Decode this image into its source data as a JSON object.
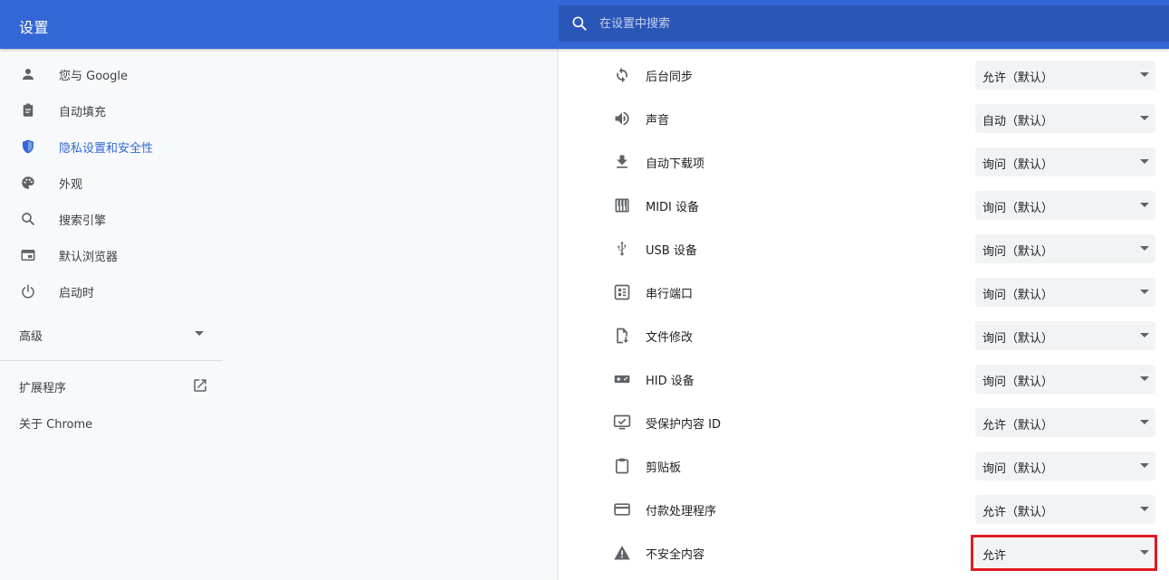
{
  "header": {
    "title": "设置",
    "search_placeholder": "在设置中搜索",
    "colors": {
      "bar": "#3367d6",
      "search_bg": "#2a56b8"
    }
  },
  "sidebar": {
    "items": [
      {
        "label": "您与 Google",
        "icon": "person-icon"
      },
      {
        "label": "自动填充",
        "icon": "clipboard-icon"
      },
      {
        "label": "隐私设置和安全性",
        "icon": "shield-icon",
        "active": true
      },
      {
        "label": "外观",
        "icon": "palette-icon"
      },
      {
        "label": "搜索引擎",
        "icon": "search-icon"
      },
      {
        "label": "默认浏览器",
        "icon": "browser-icon"
      },
      {
        "label": "启动时",
        "icon": "power-icon"
      }
    ],
    "advanced_label": "高级",
    "extensions_label": "扩展程序",
    "about_label": "关于 Chrome",
    "active_color": "#3367d6"
  },
  "permissions": [
    {
      "label": "后台同步",
      "value": "允许（默认）",
      "icon": "sync-icon"
    },
    {
      "label": "声音",
      "value": "自动（默认）",
      "icon": "speaker-icon"
    },
    {
      "label": "自动下载项",
      "value": "询问（默认）",
      "icon": "download-icon"
    },
    {
      "label": "MIDI 设备",
      "value": "询问（默认）",
      "icon": "piano-icon"
    },
    {
      "label": "USB 设备",
      "value": "询问（默认）",
      "icon": "usb-icon"
    },
    {
      "label": "串行端口",
      "value": "询问（默认）",
      "icon": "serial-port-icon"
    },
    {
      "label": "文件修改",
      "value": "询问（默认）",
      "icon": "file-edit-icon"
    },
    {
      "label": "HID 设备",
      "value": "询问（默认）",
      "icon": "gamepad-icon"
    },
    {
      "label": "受保护内容 ID",
      "value": "允许（默认）",
      "icon": "protected-content-icon"
    },
    {
      "label": "剪贴板",
      "value": "询问（默认）",
      "icon": "clipboard-icon"
    },
    {
      "label": "付款处理程序",
      "value": "允许（默认）",
      "icon": "credit-card-icon"
    },
    {
      "label": "不安全内容",
      "value": "允许",
      "icon": "warning-icon",
      "highlighted": true
    }
  ],
  "highlight_color": "#e01b24"
}
